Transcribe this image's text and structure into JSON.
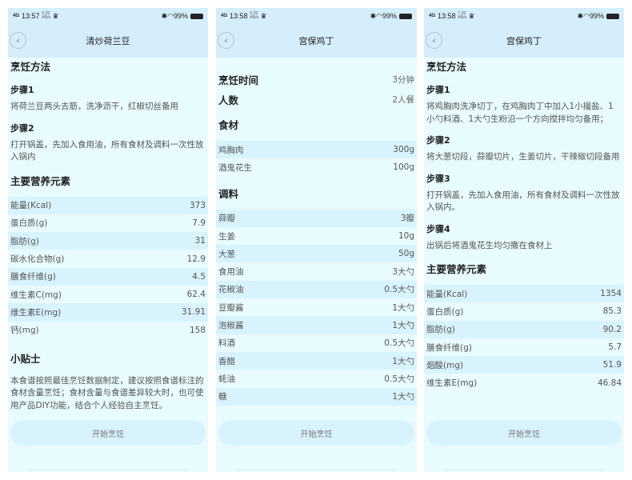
{
  "panels": [
    {
      "status": {
        "network": "4G",
        "time": "13:57",
        "speed": "0.20 KB/s",
        "battery": "99%"
      },
      "title": "清炒荷兰豆",
      "start_label": "开始烹饪",
      "method_title": "烹饪方法",
      "steps": [
        {
          "title": "步骤1",
          "text": "将荷兰豆两头去筋，洗净沥干，红椒切丝备用"
        },
        {
          "title": "步骤2",
          "text": "打开锅盖，先加入食用油，所有食材及调料一次性放入锅内"
        }
      ],
      "nutrition_title": "主要营养元素",
      "nutrition": [
        {
          "name": "能量(Kcal)",
          "value": "373"
        },
        {
          "name": "蛋白质(g)",
          "value": "7.9"
        },
        {
          "name": "脂肪(g)",
          "value": "31"
        },
        {
          "name": "碳水化合物(g)",
          "value": "12.9"
        },
        {
          "name": "膳食纤维(g)",
          "value": "4.5"
        },
        {
          "name": "维生素C(mg)",
          "value": "62.4"
        },
        {
          "name": "维生素E(mg)",
          "value": "31.91"
        },
        {
          "name": "钙(mg)",
          "value": "158"
        }
      ],
      "tips_title": "小贴士",
      "tips_text": "本食谱按照最佳烹饪数据制定，建议按照食谱标注的食材含量烹饪；食材含量与食谱差异较大时，也可使用产品DIY功能，结合个人经验自主烹饪。"
    },
    {
      "status": {
        "network": "4G",
        "time": "13:58",
        "speed": "0.20 KB/s",
        "battery": "99%"
      },
      "title": "宫保鸡丁",
      "start_label": "开始烹饪",
      "info": [
        {
          "name": "烹饪时间",
          "value": "3分钟"
        },
        {
          "name": "人数",
          "value": "2人餐"
        }
      ],
      "ingredients_title": "食材",
      "ingredients": [
        {
          "name": "鸡胸肉",
          "value": "300g"
        },
        {
          "name": "酒鬼花生",
          "value": "100g"
        }
      ],
      "seasoning_title": "调料",
      "seasonings": [
        {
          "name": "蒜瓣",
          "value": "3瓣"
        },
        {
          "name": "生姜",
          "value": "10g"
        },
        {
          "name": "大葱",
          "value": "50g"
        },
        {
          "name": "食用油",
          "value": "3大勺"
        },
        {
          "name": "花椒油",
          "value": "0.5大勺"
        },
        {
          "name": "豆瓣酱",
          "value": "1大勺"
        },
        {
          "name": "泡椒酱",
          "value": "1大勺"
        },
        {
          "name": "料酒",
          "value": "0.5大勺"
        },
        {
          "name": "香醋",
          "value": "1大勺"
        },
        {
          "name": "蚝油",
          "value": "0.5大勺"
        },
        {
          "name": "糖",
          "value": "1大勺"
        }
      ]
    },
    {
      "status": {
        "network": "4G",
        "time": "13:58",
        "speed": "7.20 KB/s",
        "battery": "99%"
      },
      "title": "宫保鸡丁",
      "start_label": "开始烹饪",
      "method_title": "烹饪方法",
      "steps": [
        {
          "title": "步骤1",
          "text": "将鸡胸肉洗净切丁，在鸡胸肉丁中加入1小撮盐、1小勺料酒、1大勺生粉沿一个方向搅拌均匀备用；"
        },
        {
          "title": "步骤2",
          "text": "将大葱切段，蒜瓣切片，生姜切片，干辣椒切段备用"
        },
        {
          "title": "步骤3",
          "text": "打开锅盖，先加入食用油，所有食材及调料一次性放入锅内。"
        },
        {
          "title": "步骤4",
          "text": "出锅后将酒鬼花生均匀撒在食材上"
        }
      ],
      "nutrition_title": "主要营养元素",
      "nutrition": [
        {
          "name": "能量(Kcal)",
          "value": "1354"
        },
        {
          "name": "蛋白质(g)",
          "value": "85.3"
        },
        {
          "name": "脂肪(g)",
          "value": "90.2"
        },
        {
          "name": "膳食纤维(g)",
          "value": "5.7"
        },
        {
          "name": "烟酸(mg)",
          "value": "51.9"
        },
        {
          "name": "维生素E(mg)",
          "value": "46.84"
        }
      ]
    }
  ]
}
